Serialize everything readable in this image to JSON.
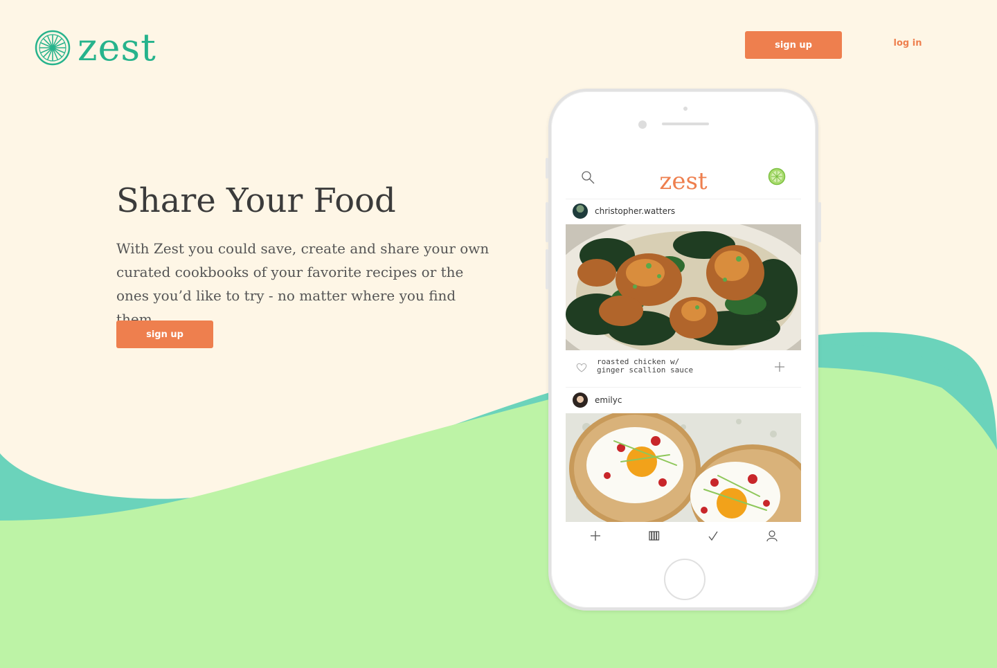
{
  "brand": {
    "name": "zest",
    "color": "#26b38c",
    "accent": "#ee7f4e"
  },
  "header": {
    "signup_label": "sign up",
    "login_label": "log in"
  },
  "hero": {
    "title": "Share Your Food",
    "description": "With Zest you could save, create and share your own curated cookbooks of your favorite recipes or the ones you’d like to try - no matter where you find them.",
    "signup_label": "sign up"
  },
  "phone_app": {
    "title": "zest",
    "posts": [
      {
        "user": "christopher.watters",
        "caption_line1": "roasted chicken w/",
        "caption_line2": "ginger scallion sauce"
      },
      {
        "user": "emilyc"
      }
    ],
    "tabs": [
      "plus-icon",
      "cookbooks-icon",
      "check-icon",
      "profile-icon"
    ]
  }
}
